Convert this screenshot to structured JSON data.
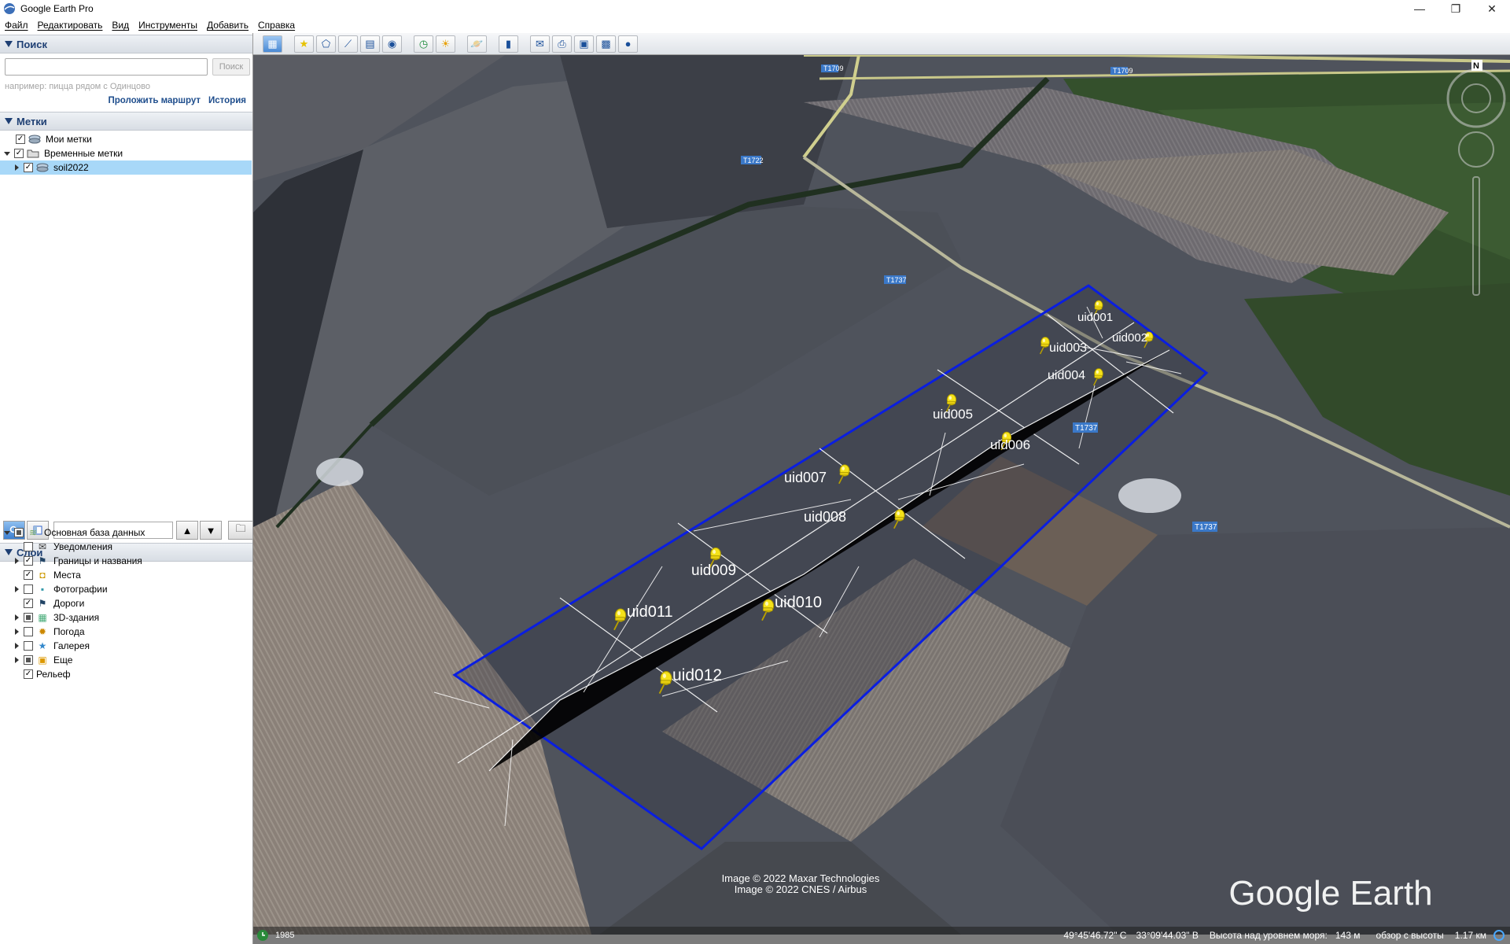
{
  "window": {
    "title": "Google Earth Pro"
  },
  "menu": [
    "Файл",
    "Редактировать",
    "Вид",
    "Инструменты",
    "Добавить",
    "Справка"
  ],
  "search_panel": {
    "header": "Поиск",
    "placeholder": "",
    "button": "Поиск",
    "hint": "например: пицца рядом с Одинцово",
    "route_link": "Проложить маршрут",
    "history_link": "История"
  },
  "places_panel": {
    "header": "Метки",
    "items": [
      {
        "label": "Мои метки",
        "checked": true
      },
      {
        "label": "Временные метки",
        "checked": true
      },
      {
        "label": "soil2022",
        "checked": true,
        "selected": true
      }
    ]
  },
  "layers_panel": {
    "header": "Слои",
    "items": [
      {
        "label": "Основная база данных"
      },
      {
        "label": "Уведомления"
      },
      {
        "label": "Границы и названия"
      },
      {
        "label": "Места"
      },
      {
        "label": "Фотографии"
      },
      {
        "label": "Дороги"
      },
      {
        "label": "3D-здания"
      },
      {
        "label": "Погода"
      },
      {
        "label": "Галерея"
      },
      {
        "label": "Еще"
      },
      {
        "label": "Рельеф"
      }
    ]
  },
  "map": {
    "road_labels": [
      "T1709",
      "T1709",
      "T1722",
      "T1737",
      "T1737",
      "T1737"
    ],
    "placemarks": [
      "uid001",
      "uid002",
      "uid003",
      "uid004",
      "uid005",
      "uid006",
      "uid007",
      "uid008",
      "uid009",
      "uid010",
      "uid011",
      "uid012"
    ],
    "compass": "N",
    "credit_1": "Image © 2022 Maxar Technologies",
    "credit_2": "Image © 2022 CNES / Airbus",
    "logo": "Google Earth"
  },
  "statusbar": {
    "year": "1985",
    "lat": "49°45'46.72\" С",
    "lon": "33°09'44.03\" В",
    "elevation_label": "Высота над уровнем моря:",
    "elevation": "143 м",
    "eye_alt_label": "обзор с высоты",
    "eye_alt": "1.17 км"
  },
  "colors": {
    "boundary": "#0a1ee0",
    "placemark": "#f5e21a",
    "sidebar_header_text": "#1e3f73",
    "selected_row": "#a8d8f8"
  }
}
